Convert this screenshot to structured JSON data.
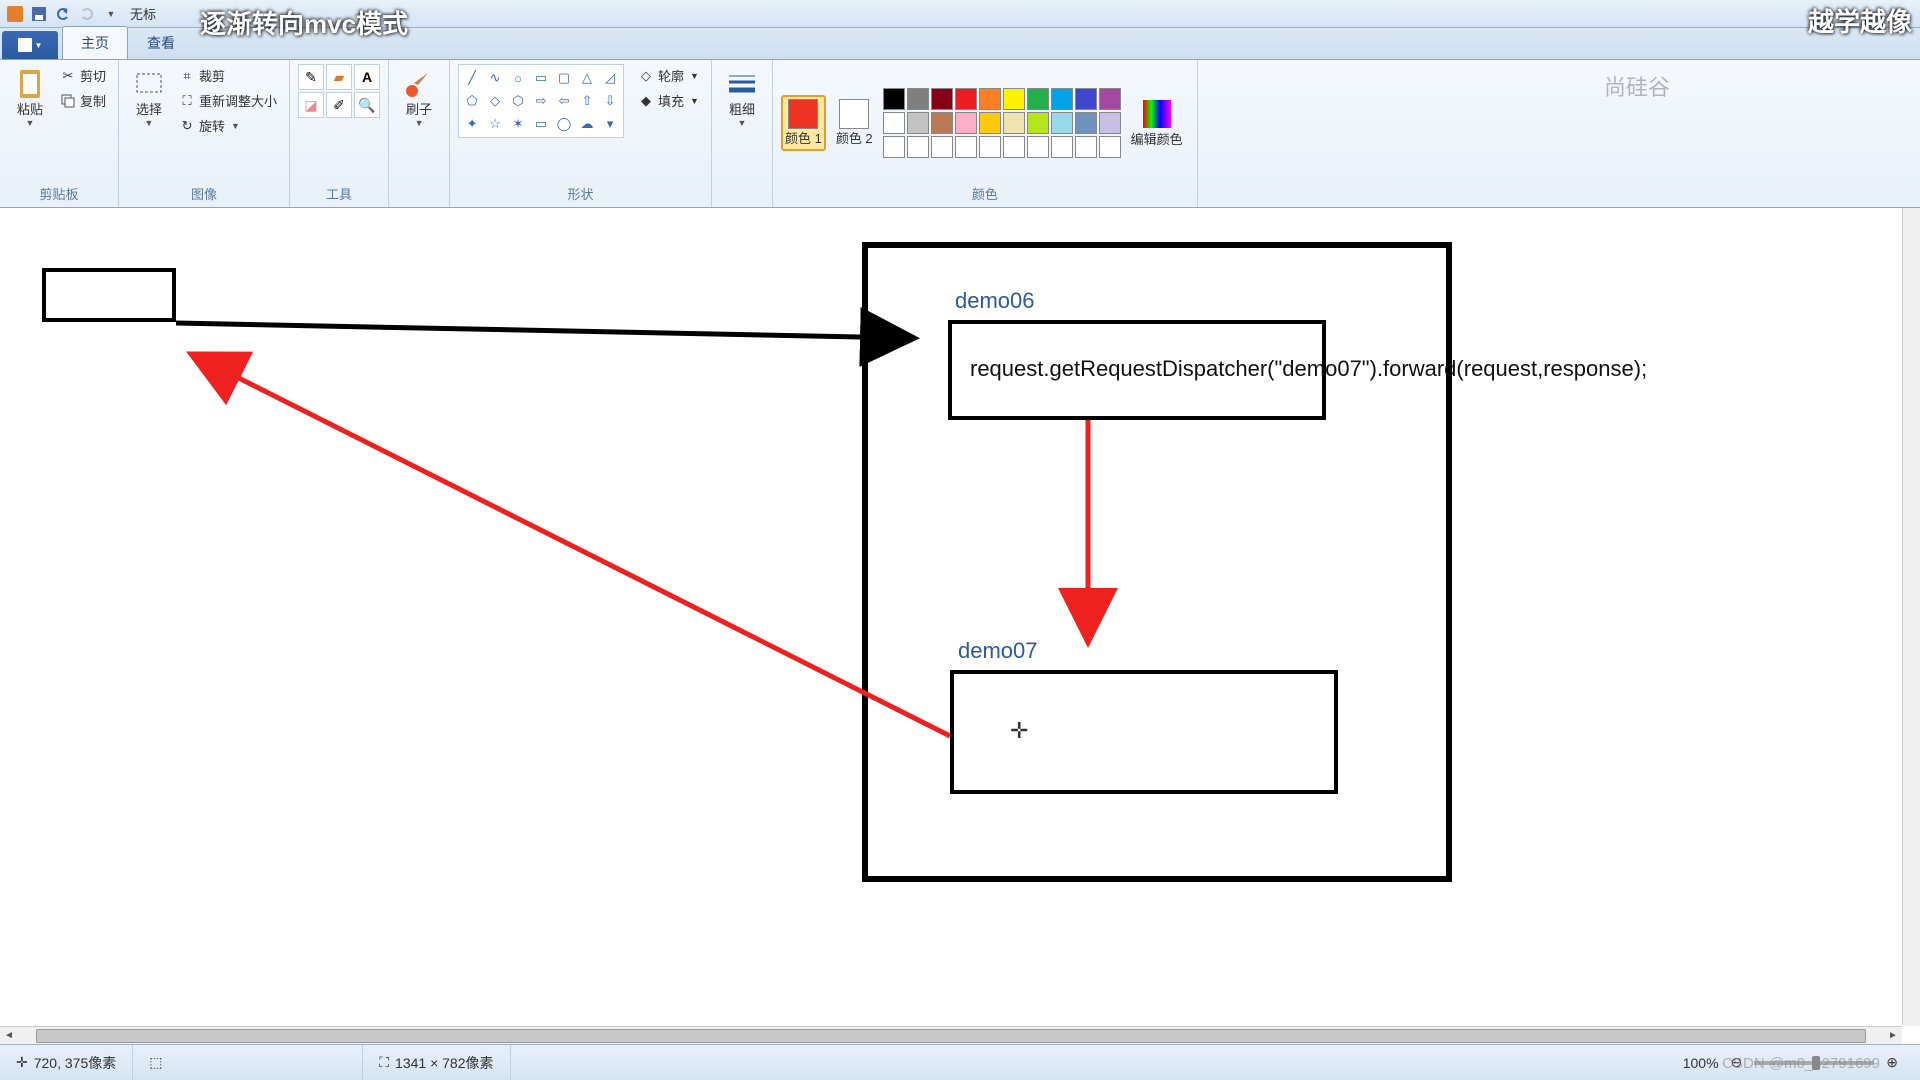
{
  "titlebar": {
    "title_prefix": "无标"
  },
  "overlay": {
    "left_text": "逐渐转向mvc模式",
    "right_text": "越学越像"
  },
  "tabs": {
    "home": "主页",
    "view": "查看"
  },
  "ribbon": {
    "clipboard": {
      "label": "剪贴板",
      "paste": "粘贴",
      "cut": "剪切",
      "copy": "复制"
    },
    "image": {
      "label": "图像",
      "select": "选择",
      "crop": "裁剪",
      "resize": "重新调整大小",
      "rotate": "旋转"
    },
    "tools": {
      "label": "工具"
    },
    "brush": {
      "label": "刷子"
    },
    "shapes": {
      "label": "形状",
      "outline": "轮廓",
      "fill": "填充"
    },
    "stroke": {
      "label": "粗细"
    },
    "colors": {
      "label": "颜色",
      "color1": "颜色 1",
      "color2": "颜色 2",
      "edit": "编辑颜色"
    }
  },
  "palette": {
    "current1": "#ee3322",
    "current2": "#ffffff",
    "row1": [
      "#000000",
      "#7f7f7f",
      "#880015",
      "#ed1c24",
      "#ff7f27",
      "#fff200",
      "#22b14c",
      "#00a2e8",
      "#3f48cc",
      "#a349a4"
    ],
    "row2": [
      "#ffffff",
      "#c3c3c3",
      "#b97a57",
      "#ffaec9",
      "#ffc90e",
      "#efe4b0",
      "#b5e61d",
      "#99d9ea",
      "#7092be",
      "#c8bfe7"
    ],
    "row3": [
      "#ffffff",
      "#ffffff",
      "#ffffff",
      "#ffffff",
      "#ffffff",
      "#ffffff",
      "#ffffff",
      "#ffffff",
      "#ffffff",
      "#ffffff"
    ]
  },
  "canvas": {
    "demo06_label": "demo06",
    "demo07_label": "demo07",
    "code_line": "request.getRequestDispatcher(\"demo07\").forward(request,response);"
  },
  "statusbar": {
    "position": "720, 375像素",
    "dimensions": "1341 × 782像素",
    "zoom": "100%"
  },
  "watermarks": {
    "top_right": "尚硅谷",
    "bottom_right": "CSDN @m0_62791699"
  }
}
